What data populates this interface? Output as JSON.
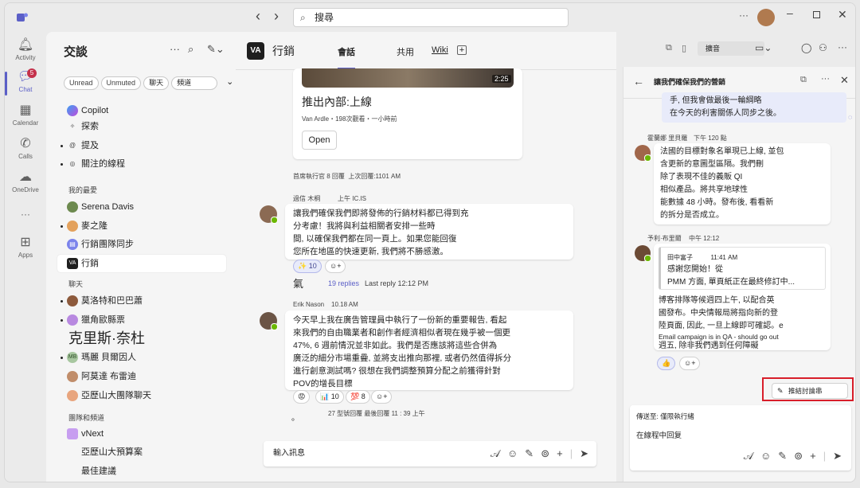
{
  "titlebar": {
    "search_placeholder": "搜尋",
    "back": "‹",
    "forward": "›",
    "more": "···"
  },
  "rail": [
    {
      "label": "Activity"
    },
    {
      "label": "Chat",
      "badge": "5"
    },
    {
      "label": "Calendar"
    },
    {
      "label": "Calls"
    },
    {
      "label": "OneDrive"
    },
    {
      "label": "···"
    },
    {
      "label": "Apps"
    }
  ],
  "sidebar": {
    "title": "交談",
    "filters": [
      "Unread",
      "Unmuted",
      "聊天",
      "頻道"
    ],
    "top": [
      {
        "label": "Copilot"
      },
      {
        "label": "探索"
      },
      {
        "label": "提及"
      },
      {
        "label": "關注的線程"
      }
    ],
    "fav_header": "我的最愛",
    "favs": [
      {
        "label": "Serena Davis"
      },
      {
        "label": "麥之隆"
      },
      {
        "label": "行銷團隊同步"
      },
      {
        "label": "行銷"
      }
    ],
    "chat_header": "聊天",
    "chats": [
      {
        "label": "莫洛特和巴巴蕭"
      },
      {
        "label": "獵角歐縣票"
      },
      {
        "label": "克里斯·奈杜"
      },
      {
        "label": "瑪麗 貝爾因人",
        "initials": "MB"
      },
      {
        "label": "阿莫達 布雷迪"
      },
      {
        "label": "亞歷山大團隊聊天"
      }
    ],
    "team_header": "團隊和頻道",
    "teams": [
      {
        "label": "vNext"
      },
      {
        "label": "亞歷山大預算案"
      },
      {
        "label": "最佳建議"
      }
    ]
  },
  "main": {
    "channel": "行銷",
    "logo": "VA",
    "tabs": [
      "會話",
      "共用",
      "Wiki"
    ],
    "card": {
      "duration": "2:25",
      "title": "推出內部:上線",
      "sub": "Van Ardle・198次觀看・一小時前",
      "button": "Open"
    },
    "card_meta": "首席執行官 8 回覆  上次回覆:1101 AM",
    "m1": {
      "author": "過信 木桐",
      "time": "上午 IC.IS",
      "lines": [
        "讓我們確保我們即將發佈的行銷材料都已得到充",
        "分考慮！我將與利益相關者安排一些時",
        "間, 以確保我們都在同一頁上。如果您能回復",
        "您所在地區的快速更新, 我們將不勝感激。"
      ],
      "react1": "✨ 10",
      "replies_prefix": "氣",
      "replies": "19 replies",
      "last": "Last reply 12:12 PM"
    },
    "m2": {
      "author": "Erik Nason",
      "time": "10.18 AM",
      "lines": [
        "今天早上我在廣告管理員中執行了一份新的重要報告, 看起",
        "來我們的自由職業者和創作者經濟相似者現在幾乎被一個更",
        "47%, 6 週前情況並非如此。我們是否應該將這些合併為",
        "廣泛的細分市場重疊, 並將支出推向那裡, 或者仍然值得拆分",
        "進行創意測試嗎? 很想在我們調整預算分配之前獲得針對",
        "POV的增長目標"
      ],
      "r1": "😡",
      "r2": "📊 10",
      "r3": "💯 8",
      "foot": "27 型號回覆 最後回覆 11 : 39 上午",
      "bullet": "。"
    },
    "compose": "輸入訊息"
  },
  "thread": {
    "title": "讓我們確保我們的營銷",
    "quote_lines": [
      "手, 但我會做最後一輪綱略",
      "在今天的利害關係人同步之後。"
    ],
    "t1": {
      "author": "霍蘭娜 里貝羅",
      "time": "下午 120 點",
      "lines": [
        "法國的目標對象名單現已上線, 並包",
        "含更新的意圖型區隔。我們刪",
        "除了表現不佳的義販 QI",
        "相似產品。將共享地球性",
        "能數據 48 小時。發布後, 看看新",
        "的拆分是否成立。"
      ]
    },
    "t2": {
      "author": "予利·布里爾",
      "time": "中午 12:12",
      "quote_author": "田中富子",
      "quote_time": "11:41 AM",
      "quote_lines": [
        "感謝您開始！從",
        "PMM 方面, 單頁紙正在最終修訂中..."
      ],
      "lines": [
        "博客排隊等候週四上午, 以配合英",
        "國發布。中央情報局將指向新的登",
        "陸頁面, 因此, 一旦上線即可確認。e"
      ],
      "email": "Email campaign is in QA - should go out",
      "last": "週五, 除非我們遇到任何障礙",
      "react": "👍"
    },
    "draft_button": "推結討論串",
    "reply_to": "傳送至: 僅限執行緒",
    "reply_text": "在線程中回复"
  }
}
